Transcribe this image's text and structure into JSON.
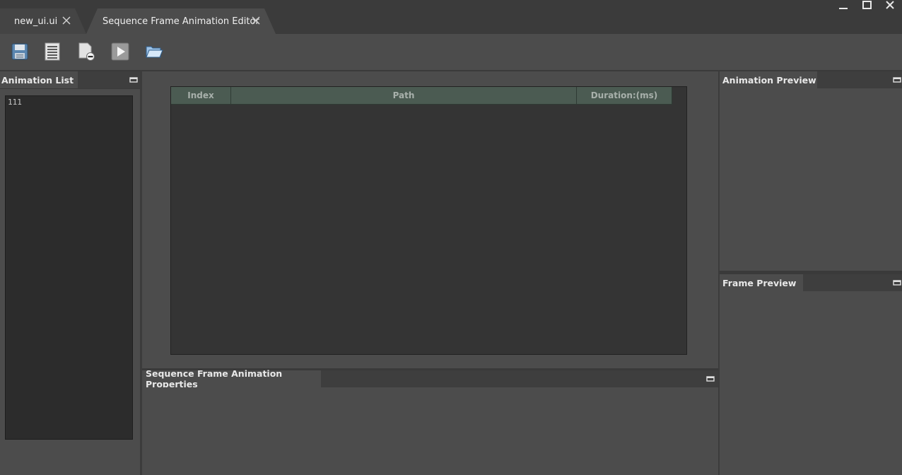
{
  "tabs": [
    {
      "label": "new_ui.ui",
      "active": false
    },
    {
      "label": "Sequence Frame Animation Editor",
      "active": true
    }
  ],
  "window_controls": [
    "minimize-icon",
    "maximize-icon",
    "close-icon"
  ],
  "toolbar": {
    "buttons": [
      "save-icon",
      "list-icon",
      "remove-file-icon",
      "play-icon",
      "open-folder-icon"
    ]
  },
  "animation_list": {
    "title": "Animation List",
    "items": [
      "111"
    ]
  },
  "frame_table": {
    "columns": [
      "Index",
      "Path",
      "Duration:(ms)"
    ],
    "header_color": "#4b5b52"
  },
  "properties": {
    "title": "Sequence Frame Animation Properties"
  },
  "animation_preview": {
    "title": "Animation Preview"
  },
  "frame_preview": {
    "title": "Frame Preview"
  }
}
